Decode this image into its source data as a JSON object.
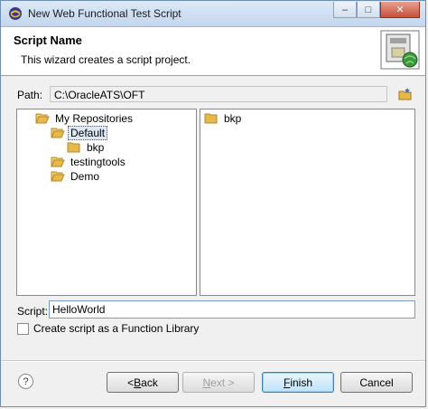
{
  "window": {
    "title": "New Web Functional Test Script",
    "controls": [
      "minimize",
      "maximize",
      "close"
    ]
  },
  "header": {
    "title": "Script Name",
    "description": "This wizard creates a script project."
  },
  "path": {
    "label": "Path:",
    "value": "C:\\OracleATS\\OFT"
  },
  "tree": {
    "items": [
      {
        "label": "My Repositories",
        "level": 0,
        "selected": false
      },
      {
        "label": "Default",
        "level": 1,
        "selected": true
      },
      {
        "label": "bkp",
        "level": 2,
        "selected": false
      },
      {
        "label": "testingtools",
        "level": 1,
        "selected": false
      },
      {
        "label": "Demo",
        "level": 1,
        "selected": false
      }
    ]
  },
  "list": {
    "items": [
      {
        "label": "bkp"
      }
    ]
  },
  "script": {
    "label": "Script:",
    "value": "HelloWorld"
  },
  "function_library": {
    "label": "Create script as a Function Library",
    "checked": false
  },
  "buttons": {
    "back_prefix": "< ",
    "back_key": "B",
    "back_rest": "ack",
    "next_key": "N",
    "next_rest": "ext >",
    "finish_key": "F",
    "finish_rest": "inish",
    "cancel": "Cancel"
  },
  "colors": {
    "folder": "#e8b84a",
    "selection": "#dde8f6",
    "primary_button": "#bfe3f8"
  }
}
